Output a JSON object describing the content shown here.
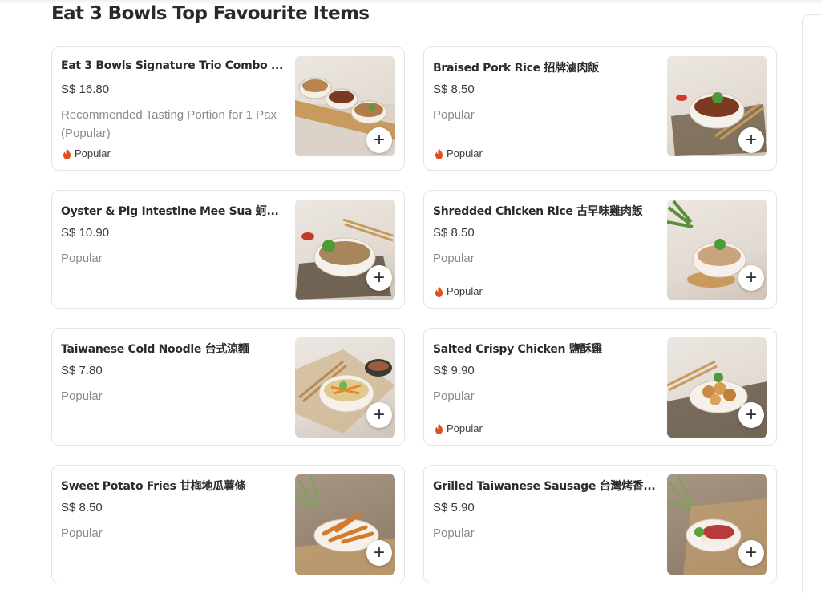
{
  "section": {
    "title": "Eat 3 Bowls Top Favourite Items"
  },
  "colors": {
    "fire": "#e0501e",
    "border": "#e4e4e4"
  },
  "items": [
    {
      "name": "Eat 3 Bowls Signature Trio Combo ...",
      "price": "S$ 16.80",
      "desc": "Recommended Tasting Portion for 1 Pax (Popular)",
      "tag": "Popular",
      "add": "+"
    },
    {
      "name": "Braised Pork Rice 招牌滷肉飯",
      "price": "S$ 8.50",
      "desc": "Popular",
      "tag": "Popular",
      "add": "+"
    },
    {
      "name": "Oyster & Pig Intestine Mee Sua 蚵...",
      "price": "S$ 10.90",
      "desc": "Popular",
      "tag": "",
      "add": "+"
    },
    {
      "name": "Shredded Chicken Rice 古早味雞肉飯",
      "price": "S$ 8.50",
      "desc": "Popular",
      "tag": "Popular",
      "add": "+"
    },
    {
      "name": "Taiwanese Cold Noodle 台式涼麵",
      "price": "S$ 7.80",
      "desc": "Popular",
      "tag": "",
      "add": "+"
    },
    {
      "name": "Salted Crispy Chicken 鹽酥雞",
      "price": "S$ 9.90",
      "desc": "Popular",
      "tag": "Popular",
      "add": "+"
    },
    {
      "name": "Sweet Potato Fries 甘梅地瓜薯條",
      "price": "S$ 8.50",
      "desc": "Popular",
      "tag": "",
      "add": "+"
    },
    {
      "name": "Grilled Taiwanese Sausage 台灣烤香...",
      "price": "S$ 5.90",
      "desc": "Popular",
      "tag": "",
      "add": "+"
    }
  ]
}
